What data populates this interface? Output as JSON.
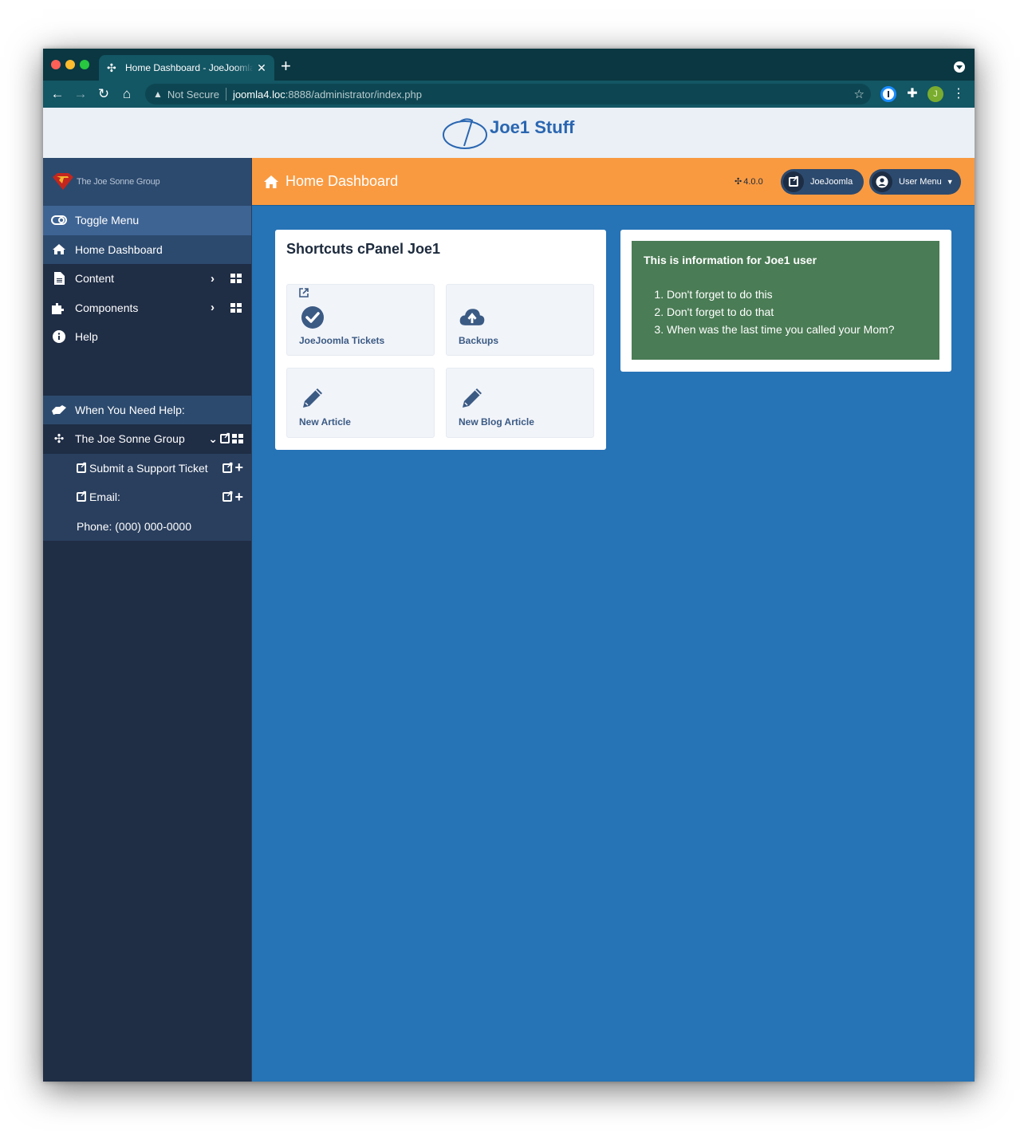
{
  "browser": {
    "tab_title": "Home Dashboard - JoeJoomla",
    "tab_icon": "joomla-icon",
    "new_tab_label": "+",
    "address": {
      "security_label": "Not Secure",
      "host": "joomla4.loc",
      "path": ":8888/administrator/index.php"
    },
    "profile_initial": "J"
  },
  "site_header": {
    "brand": "Joe1 Stuff"
  },
  "sidebar": {
    "brand_name": "The Joe Sonne Group",
    "toggle_label": "Toggle Menu",
    "items": [
      {
        "label": "Home Dashboard",
        "icon": "home-icon"
      },
      {
        "label": "Content",
        "icon": "file-icon"
      },
      {
        "label": "Components",
        "icon": "puzzle-icon"
      },
      {
        "label": "Help",
        "icon": "info-icon"
      }
    ],
    "help_group": {
      "heading": "When You Need Help:",
      "parent": "The Joe Sonne Group",
      "children": [
        {
          "label": "Submit a Support Ticket"
        },
        {
          "label": "Email:"
        },
        {
          "label": "Phone: (000) 000-0000"
        }
      ]
    }
  },
  "topbar": {
    "title": "Home Dashboard",
    "version": "4.0.0",
    "site_button": "JoeJoomla",
    "user_menu": "User Menu"
  },
  "shortcuts": {
    "title": "Shortcuts cPanel Joe1",
    "tiles": [
      {
        "label": "JoeJoomla Tickets",
        "icon": "check-circle-icon",
        "external": true
      },
      {
        "label": "Backups",
        "icon": "cloud-upload-icon"
      },
      {
        "label": "New Article",
        "icon": "pencil-icon"
      },
      {
        "label": "New Blog Article",
        "icon": "pencil-icon"
      }
    ]
  },
  "info": {
    "title": "This is information for Joe1 user",
    "items": [
      "Don't forget to do this",
      "Don't forget to do that",
      "When was the last time you called your Mom?"
    ],
    "bg_color": "#4a7c55"
  },
  "colors": {
    "topbar": "#f99a41",
    "sidebar": "#1f2d45",
    "main": "#2673b6"
  }
}
